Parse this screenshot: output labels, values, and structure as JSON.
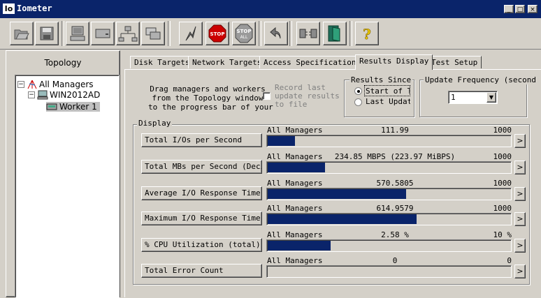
{
  "window": {
    "icon_text": "Io",
    "title": "Iometer",
    "controls": [
      "_",
      "□",
      "×"
    ]
  },
  "toolbar": {
    "buttons": [
      {
        "name": "open-icon"
      },
      {
        "name": "save-icon"
      },
      {
        "name": "new-manager-icon"
      },
      {
        "name": "new-disk-worker-icon"
      },
      {
        "name": "new-network-worker-icon"
      },
      {
        "name": "duplicate-worker-icon"
      },
      {
        "name": "start-tests-icon"
      },
      {
        "name": "stop-icon",
        "label": "STOP"
      },
      {
        "name": "stop-all-icon",
        "label": "STOP ALL"
      },
      {
        "name": "reset-workers-icon"
      },
      {
        "name": "disconnect-icon"
      },
      {
        "name": "exit-icon"
      },
      {
        "name": "help-icon",
        "label": "?"
      }
    ]
  },
  "topology": {
    "title": "Topology",
    "tree": [
      {
        "label": "All Managers",
        "toggle": "−"
      },
      {
        "label": "WIN2012AD",
        "toggle": "−"
      },
      {
        "label": "Worker 1"
      }
    ]
  },
  "tabs": [
    {
      "label": "Disk Targets"
    },
    {
      "label": "Network Targets"
    },
    {
      "label": "Access Specifications"
    },
    {
      "label": "Results Display",
      "active": true
    },
    {
      "label": "Test Setup"
    }
  ],
  "results": {
    "drag_hint": [
      "Drag managers and workers",
      "from the Topology window",
      "to the progress bar of your"
    ],
    "record_last": [
      "Record last",
      "update results",
      "to file"
    ],
    "results_since_title": "Results Since",
    "results_since_options": [
      "Start of T",
      "Last Updat"
    ],
    "update_frequency_title": "Update Frequency (seconds)",
    "update_frequency_value": "1",
    "display_title": "Display"
  },
  "metrics": [
    {
      "name": "Total I/Os per Second",
      "target": "All Managers",
      "value": "111.99",
      "max": "1000",
      "fraction": 0.112
    },
    {
      "name": "Total MBs per Second (Decima",
      "target": "All Managers",
      "value": "234.85 MBPS (223.97 MiBPS)",
      "max": "1000",
      "fraction": 0.235
    },
    {
      "name": "Average I/O Response Time (m",
      "target": "All Managers",
      "value": "570.5805",
      "max": "1000",
      "fraction": 0.571
    },
    {
      "name": "Maximum I/O Response Time (m",
      "target": "All Managers",
      "value": "614.9579",
      "max": "1000",
      "fraction": 0.615
    },
    {
      "name": "% CPU Utilization (total)",
      "target": "All Managers",
      "value": "2.58 %",
      "max": "10 %",
      "fraction": 0.258
    },
    {
      "name": "Total Error Count",
      "target": "All Managers",
      "value": "0",
      "max": "0",
      "fraction": 0
    }
  ],
  "colors": {
    "titlebar": "#0a246a",
    "bar_fill": "#0a246a",
    "face": "#d4d0c8",
    "stop_red": "#cc0000"
  }
}
